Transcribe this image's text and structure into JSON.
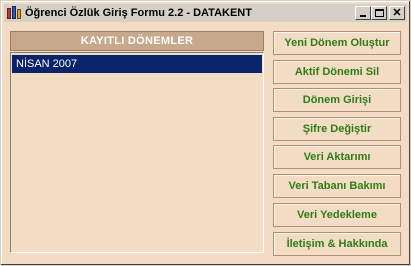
{
  "window": {
    "title": "Öğrenci Özlük Giriş Formu 2.2 - DATAKENT",
    "icon": "app-books-icon",
    "controls": [
      "minimize-icon",
      "maximize-icon",
      "close-icon"
    ],
    "close_glyph": "✕"
  },
  "periods_panel": {
    "header": "KAYITLI DÖNEMLER",
    "items": [
      "NİSAN 2007"
    ],
    "selected_index": 0
  },
  "actions": {
    "new_period": "Yeni Dönem Oluştur",
    "delete_active": "Aktif Dönemi Sil",
    "period_entry": "Dönem Girişi",
    "change_password": "Şifre Değiştir",
    "transfer_data": "Veri Aktarımı",
    "db_maintenance": "Veri Tabanı Bakımı",
    "backup_data": "Veri Yedekleme",
    "contact_about": "İletişim & Hakkında"
  },
  "colors": {
    "window_bg": "#f2dcc4",
    "header_bg": "#c8a88a",
    "button_text": "#2f7d16",
    "selection_bg": "#0a246a"
  }
}
